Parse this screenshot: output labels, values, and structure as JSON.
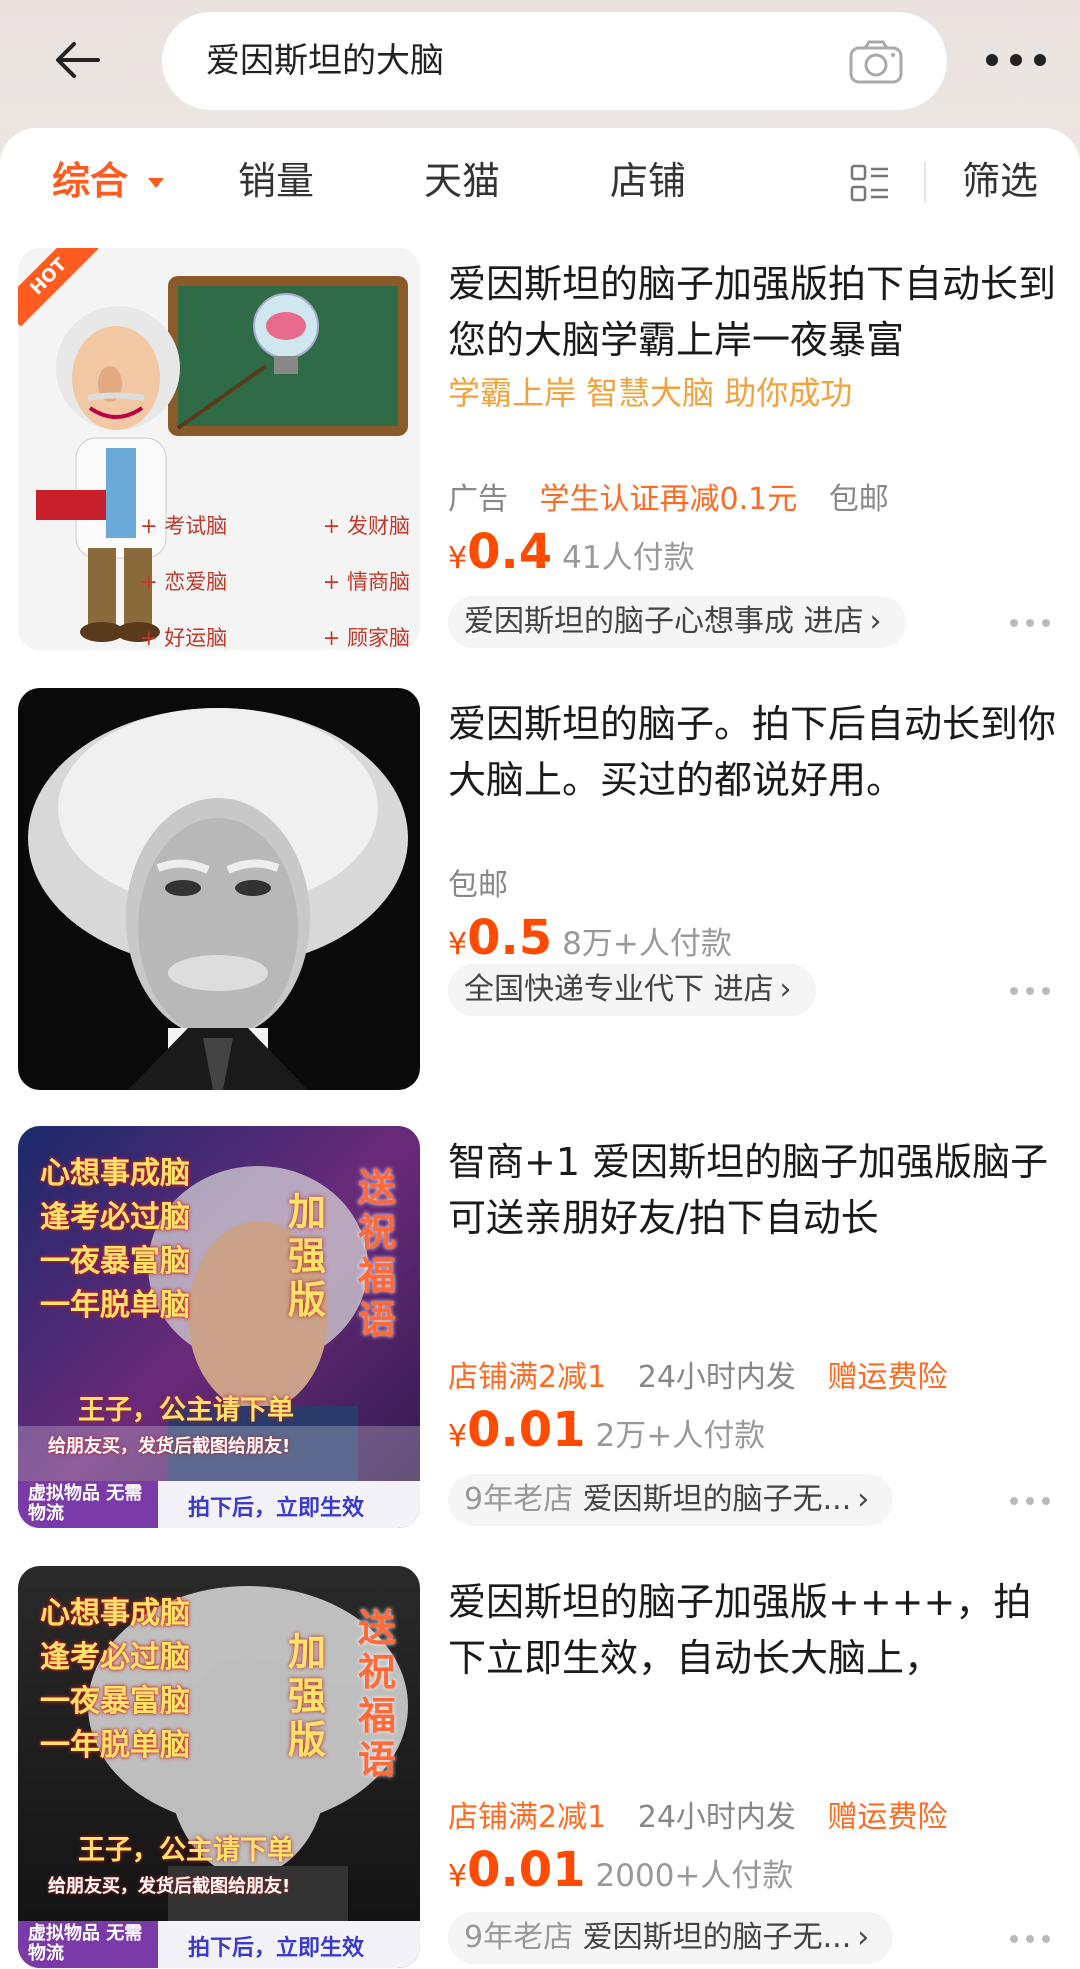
{
  "header": {
    "search_query": "爱因斯坦的大脑"
  },
  "tabs": [
    {
      "label": "综合",
      "active": true
    },
    {
      "label": "销量",
      "active": false
    },
    {
      "label": "天猫",
      "active": false
    },
    {
      "label": "店铺",
      "active": false
    },
    {
      "label": "筛选",
      "active": false
    }
  ],
  "products": [
    {
      "title": "爱因斯坦的脑子加强版拍下自动长到您的大脑学霸上岸一夜暴富",
      "slogan": "学霸上岸 智慧大脑 助你成功",
      "tag_ad": "广告",
      "tag_promo": "学生认证再减0.1元",
      "tag_shipping": "包邮",
      "price_symbol": "¥",
      "price": "0.4",
      "sold": "41人付款",
      "shop": "爱因斯坦的脑子心想事成 进店",
      "image": {
        "badge": "HOT",
        "labels": [
          "考试脑",
          "发财脑",
          "恋爱脑",
          "情商脑",
          "好运脑",
          "顾家脑"
        ]
      }
    },
    {
      "title": "爱因斯坦的脑子。拍下后自动长到你大脑上。买过的都说好用。",
      "tag_shipping": "包邮",
      "price_symbol": "¥",
      "price": "0.5",
      "sold": "8万+人付款",
      "shop": "全国快递专业代下 进店"
    },
    {
      "title": "智商+1 爱因斯坦的脑子加强版脑子可送亲朋好友/拍下自动长",
      "tag_promo": "店铺满2减1",
      "tag_delivery": "24小时内发",
      "tag_insurance": "赠运费险",
      "price_symbol": "¥",
      "price": "0.01",
      "sold": "2万+人付款",
      "shop_age": "9年老店",
      "shop": "爱因斯坦的脑子无...",
      "image": {
        "lines": [
          "心想事成脑",
          "逢考必过脑",
          "一夜暴富脑",
          "一年脱单脑"
        ],
        "vertical_1": "加强版",
        "vertical_2": "送祝福语",
        "prince": "王子，公主请下单",
        "share": "给朋友买，发货后截图给朋友!",
        "virtual": "虚拟物品 无需物流",
        "effect": "拍下后，立即生效"
      }
    },
    {
      "title": "爱因斯坦的脑子加强版++++，拍下立即生效，自动长大脑上，",
      "tag_promo": "店铺满2减1",
      "tag_delivery": "24小时内发",
      "tag_insurance": "赠运费险",
      "price_symbol": "¥",
      "price": "0.01",
      "sold": "2000+人付款",
      "shop_age": "9年老店",
      "shop": "爱因斯坦的脑子无...",
      "image": {
        "lines": [
          "心想事成脑",
          "逢考必过脑",
          "一夜暴富脑",
          "一年脱单脑"
        ],
        "vertical_1": "加强版",
        "vertical_2": "送祝福语",
        "prince": "王子，公主请下单",
        "share": "给朋友买，发货后截图给朋友!",
        "virtual": "虚拟物品 无需物流",
        "effect": "拍下后，立即生效"
      }
    }
  ],
  "colors": {
    "accent": "#ff5b1f",
    "price": "#ff4a00",
    "slogan": "#f2a23b"
  }
}
